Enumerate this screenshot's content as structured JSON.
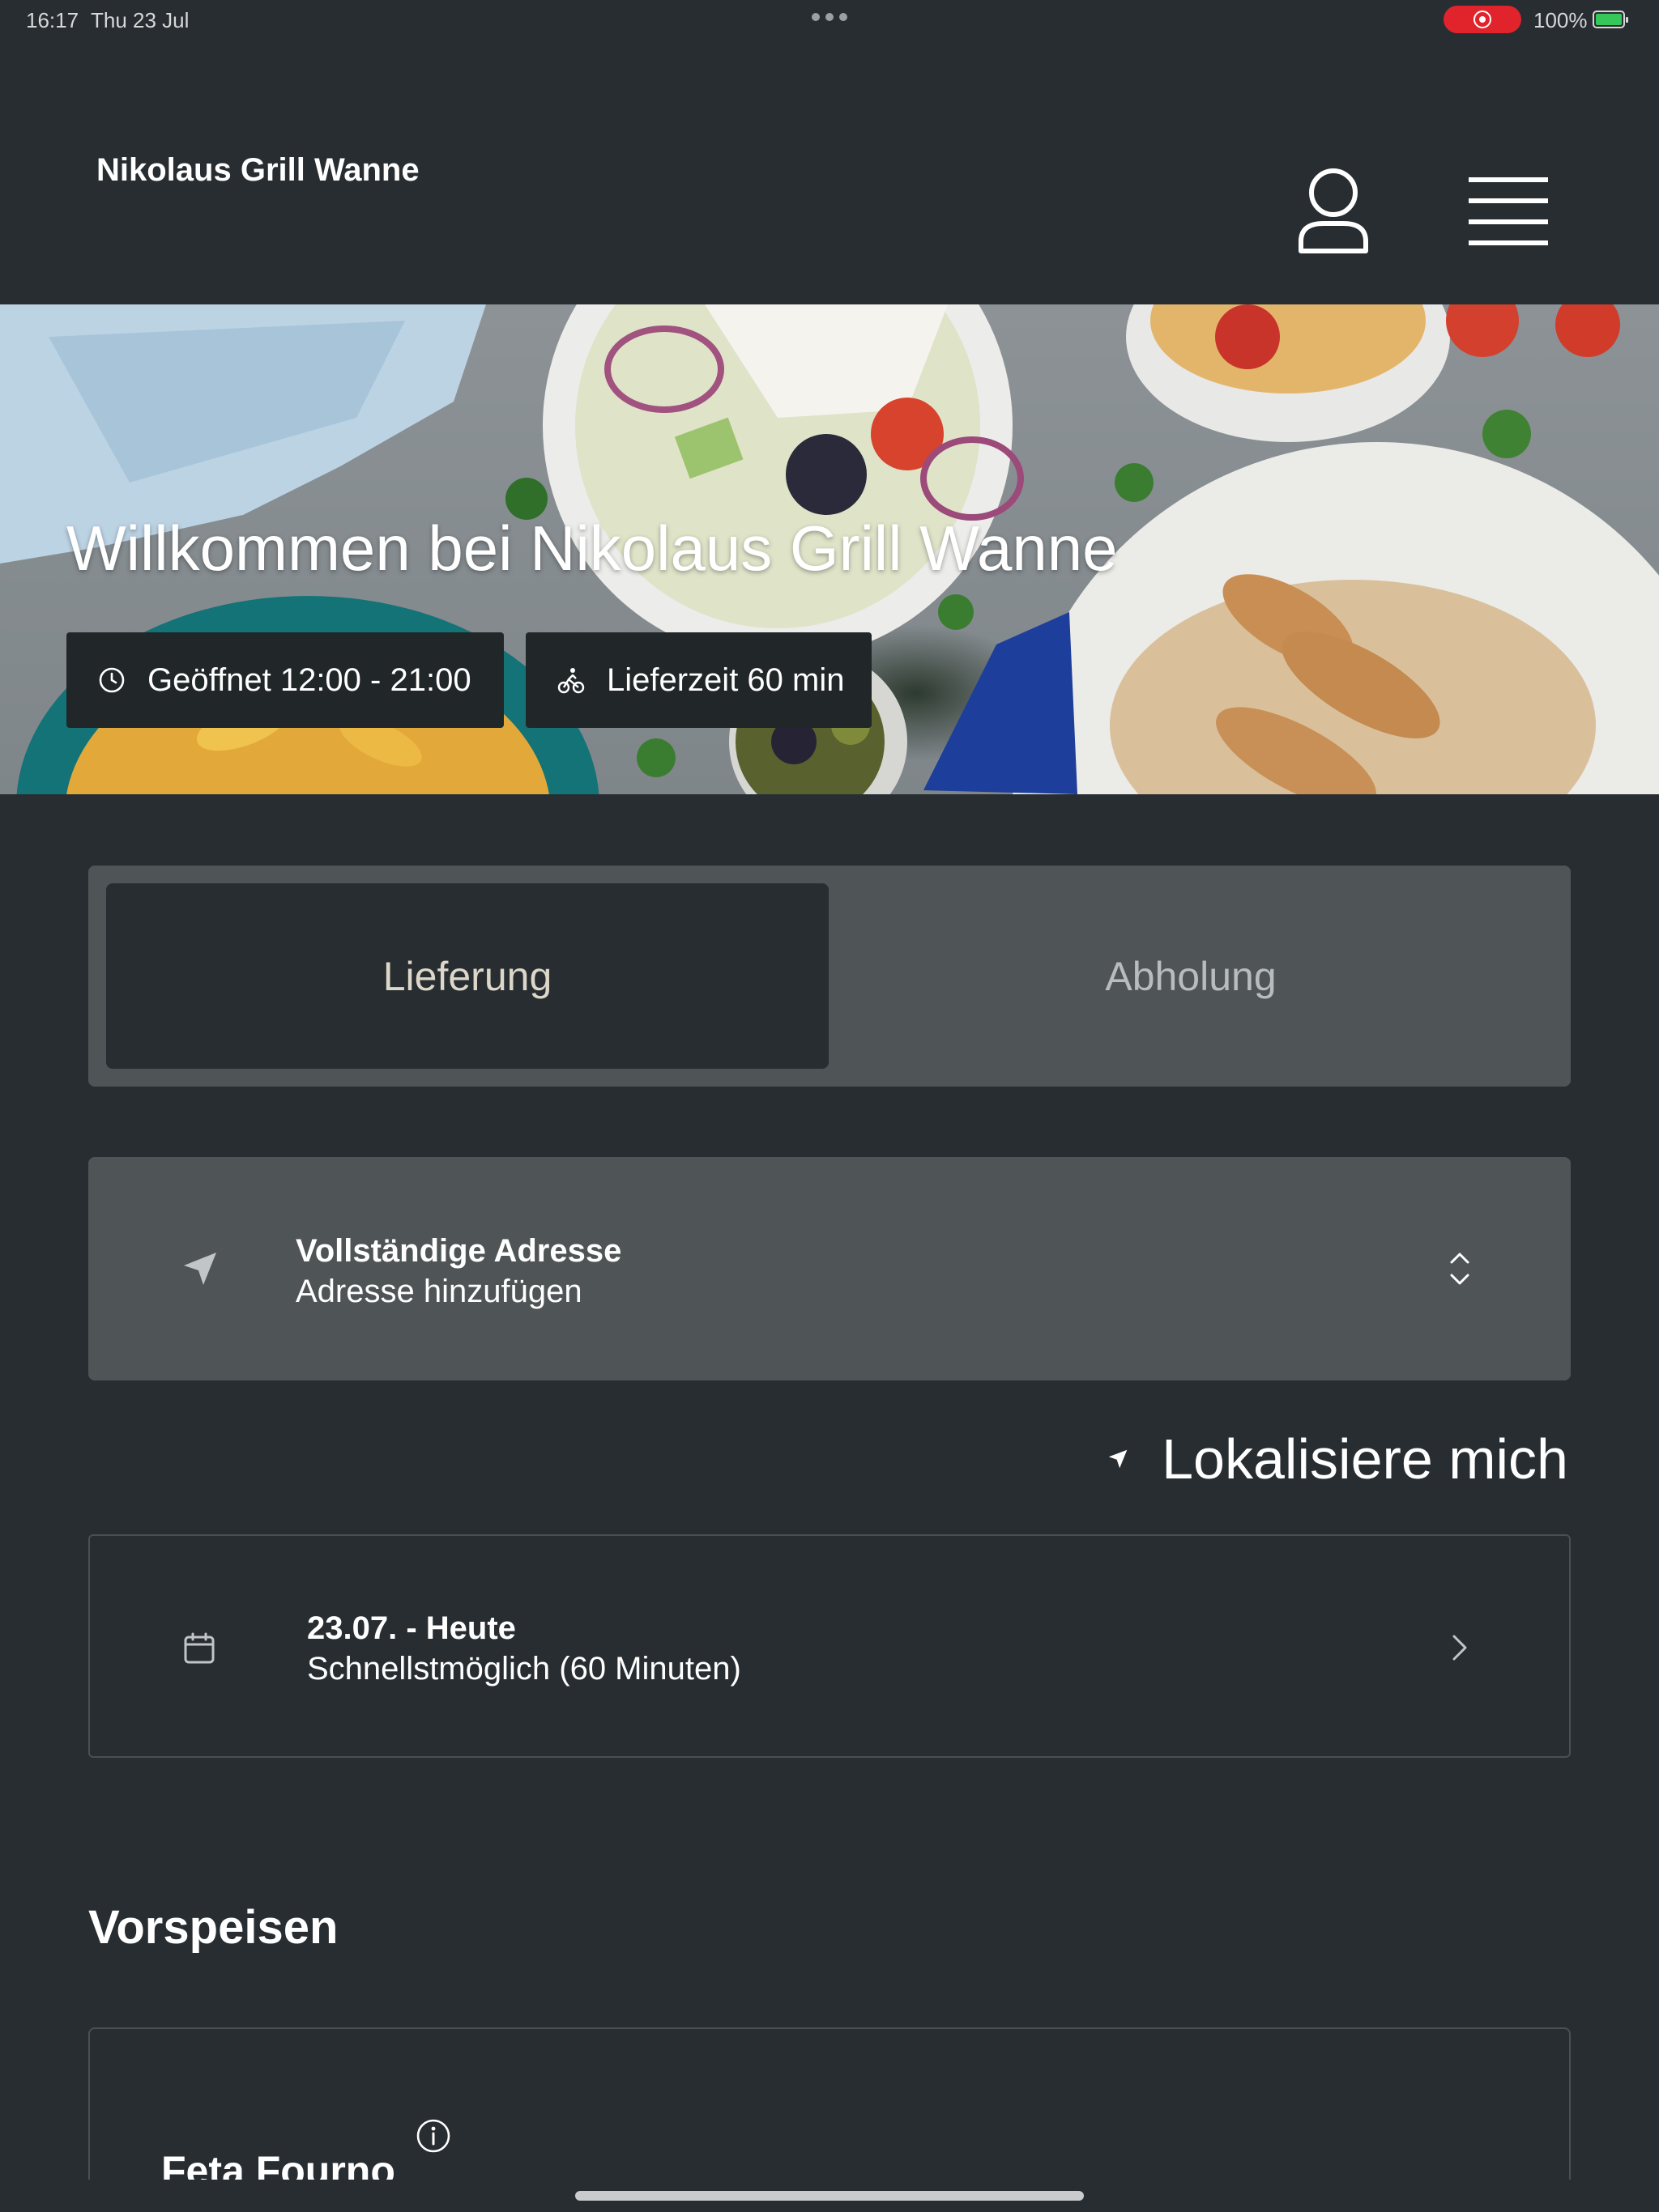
{
  "status_bar": {
    "time": "16:17",
    "date": "Thu 23 Jul",
    "battery": "100%"
  },
  "header": {
    "brand": "Nikolaus Grill Wanne",
    "user_icon": "user-icon",
    "menu_icon": "hamburger-menu-icon"
  },
  "hero": {
    "title": "Willkommen bei Nikolaus Grill Wanne",
    "chips": {
      "opening": "Geöffnet 12:00 - 21:00",
      "delivery_time": "Lieferzeit 60 min"
    }
  },
  "mode_toggle": {
    "options": [
      "Lieferung",
      "Abholung"
    ],
    "selected": "Lieferung"
  },
  "address": {
    "title": "Vollständige Adresse",
    "placeholder": "Adresse hinzufügen"
  },
  "locate": {
    "label": "Lokalisiere mich"
  },
  "schedule": {
    "date": "23.07. - Heute",
    "time": "Schnellstmöglich (60 Minuten)"
  },
  "menu": {
    "section_title": "Vorspeisen",
    "items": [
      {
        "name": "Feta Fourno"
      }
    ]
  },
  "colors": {
    "background": "#272d31",
    "panel": "#4f5457",
    "chip": "#212629",
    "record": "#e1242b",
    "battery": "#35c759",
    "selected_text": "#dcd7c9"
  }
}
